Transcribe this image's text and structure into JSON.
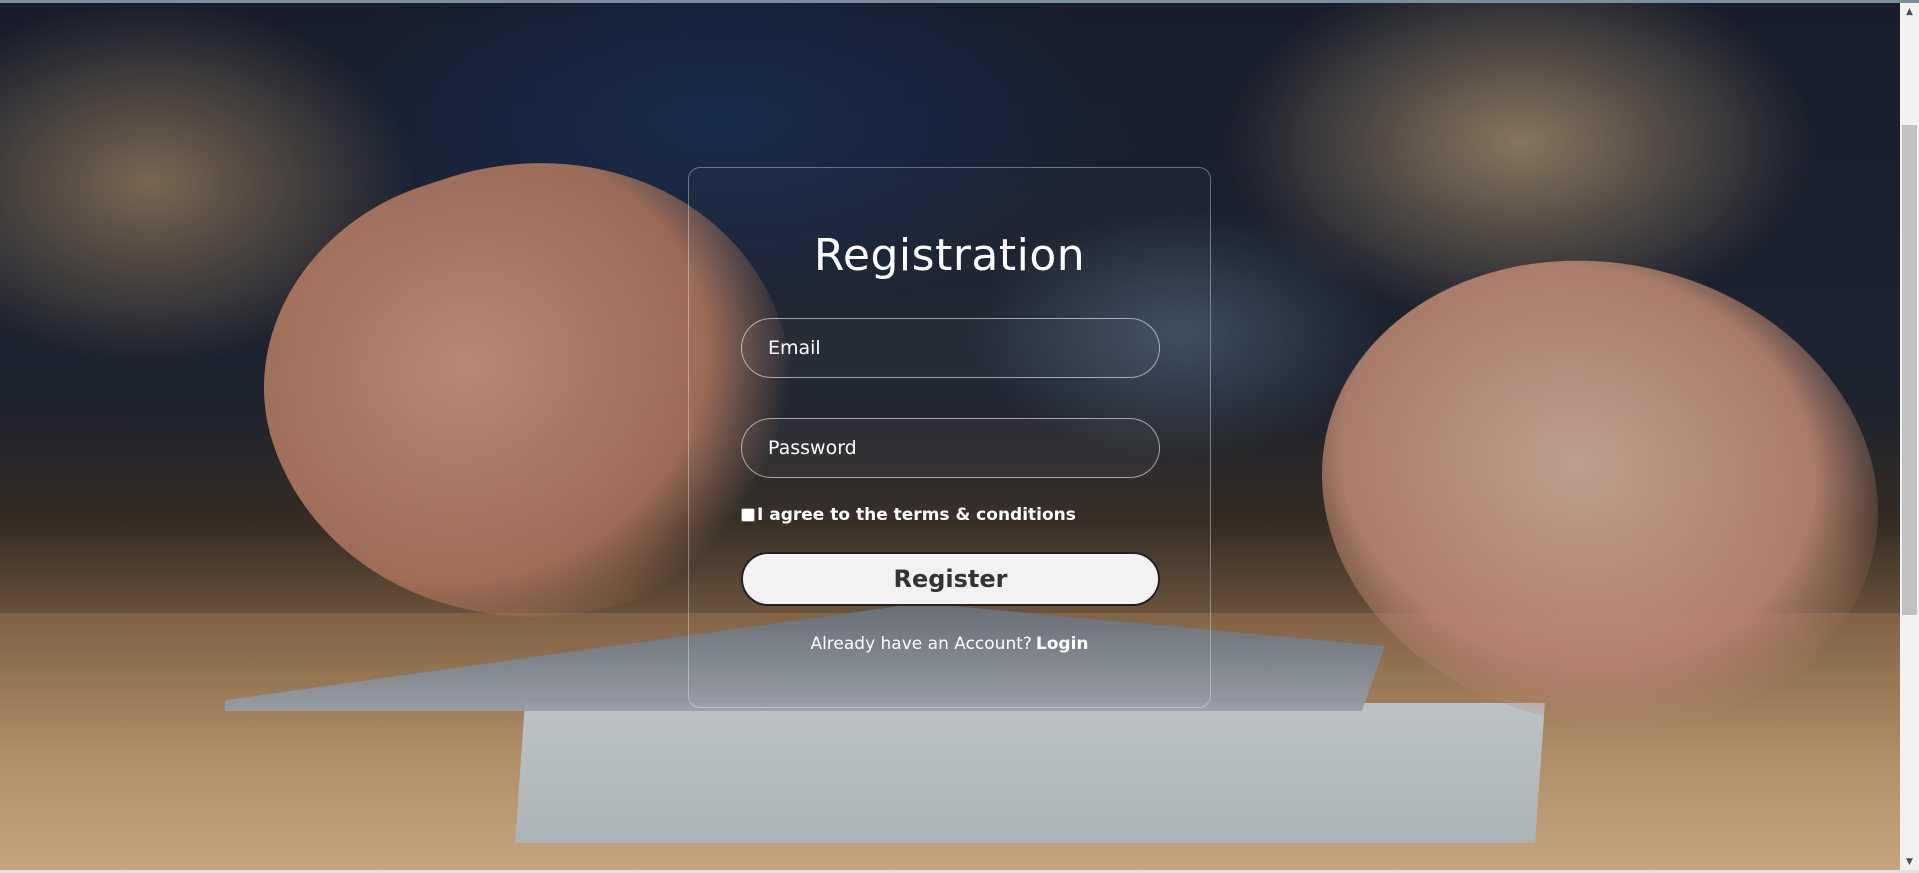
{
  "form": {
    "title": "Registration",
    "email_placeholder": "Email",
    "password_placeholder": "Password",
    "terms_label": "I agree to the terms & conditions",
    "terms_checked": false,
    "register_label": "Register",
    "login_prompt": "Already have an Account?",
    "login_link": "Login"
  },
  "colors": {
    "card_border": "#ffffff",
    "text": "#ffffff",
    "button_bg": "#f2f2f2",
    "button_text": "#333333"
  },
  "icons": {
    "scroll_up": "triangle-up",
    "scroll_down": "triangle-down"
  }
}
